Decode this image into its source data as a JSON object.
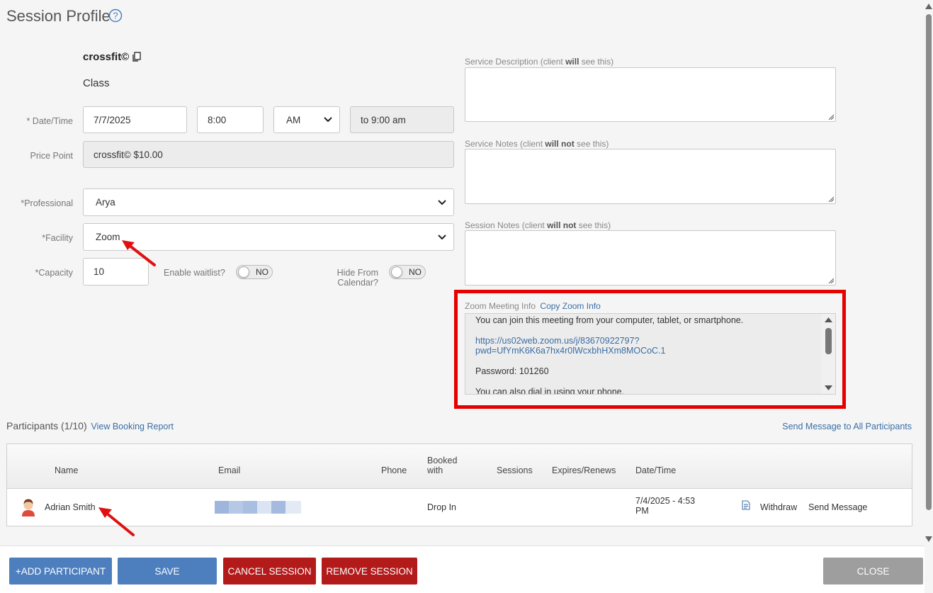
{
  "page": {
    "title": "Session Profile"
  },
  "service": {
    "name": "crossfit©",
    "type": "Class"
  },
  "form": {
    "datetime_label": "* Date/Time",
    "date_value": "7/7/2025",
    "time_value": "8:00",
    "ampm_value": "AM",
    "end_time": "to 9:00 am",
    "price_label": "Price Point",
    "price_value": "crossfit© $10.00",
    "professional_label": "*Professional",
    "professional_value": "Arya",
    "facility_label": "*Facility",
    "facility_value": "Zoom",
    "capacity_label": "*Capacity",
    "capacity_value": "10",
    "waitlist_label": "Enable waitlist?",
    "waitlist_state": "NO",
    "hide_label_line1": "Hide From",
    "hide_label_line2": "Calendar?",
    "hide_state": "NO"
  },
  "notes": {
    "desc_prefix": "Service Description (client ",
    "desc_bold": "will",
    "desc_suffix": " see this)",
    "service_prefix": "Service Notes (client ",
    "service_bold": "will not",
    "service_suffix": " see this)",
    "session_prefix": "Session Notes (client ",
    "session_bold": "will not",
    "session_suffix": " see this)"
  },
  "zoom": {
    "label": "Zoom Meeting Info",
    "copy_link": "Copy Zoom Info",
    "line1": "You can join this meeting from your computer, tablet, or smartphone.",
    "url_line1": "https://us02web.zoom.us/j/83670922797?",
    "url_line2": "pwd=UfYmK6K6a7hx4r0lWcxbhHXm8MOCoC.1",
    "password": "Password: 101260",
    "line4": "You can also dial in using your phone."
  },
  "participants": {
    "heading": "Participants (1/10)",
    "report_link": "View Booking Report",
    "message_all_link": "Send Message to All Participants",
    "columns": [
      "Name",
      "Email",
      "Phone",
      "Booked with",
      "Sessions",
      "Expires/Renews",
      "Date/Time"
    ],
    "booked_col_line1": "Booked",
    "booked_col_line2": "with",
    "rows": [
      {
        "name": "Adrian Smith",
        "phone": "",
        "booked_with": "Drop In",
        "sessions": "",
        "expires": "",
        "datetime_line1": "7/4/2025 - 4:53",
        "datetime_line2": "PM",
        "withdraw": "Withdraw",
        "send_message": "Send Message"
      }
    ]
  },
  "footer": {
    "add_participant": "+ADD PARTICIPANT",
    "save": "SAVE",
    "cancel_session": "CANCEL SESSION",
    "remove_session": "REMOVE SESSION",
    "close": "CLOSE"
  },
  "colors": {
    "primary": "#4d7fbf",
    "danger": "#b31b1b",
    "neutral": "#9e9e9e",
    "highlight": "#e60000",
    "link": "#3a6ea5"
  }
}
